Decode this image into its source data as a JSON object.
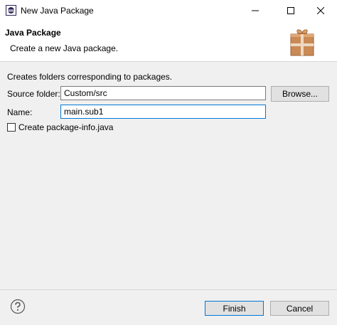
{
  "window": {
    "title": "New Java Package",
    "icon": "eclipse-icon",
    "controls": [
      "minimize-icon",
      "maximize-icon",
      "close-icon"
    ]
  },
  "banner": {
    "title": "Java Package",
    "subtitle": "Create a new Java package.",
    "image": "package-wizard-icon"
  },
  "form": {
    "description": "Creates folders corresponding to packages.",
    "source_folder_label": "Source folder:",
    "source_folder_value": "Custom/src",
    "browse_label": "Browse...",
    "name_label": "Name:",
    "name_value": "main.sub1",
    "create_info_label": "Create package-info.java",
    "create_info_checked": false
  },
  "footer": {
    "help_icon": "help-icon",
    "finish_label": "Finish",
    "cancel_label": "Cancel"
  },
  "colors": {
    "focus_border": "#0078d7",
    "dialog_bg": "#f0f0f0",
    "button_bg": "#e1e1e1"
  }
}
